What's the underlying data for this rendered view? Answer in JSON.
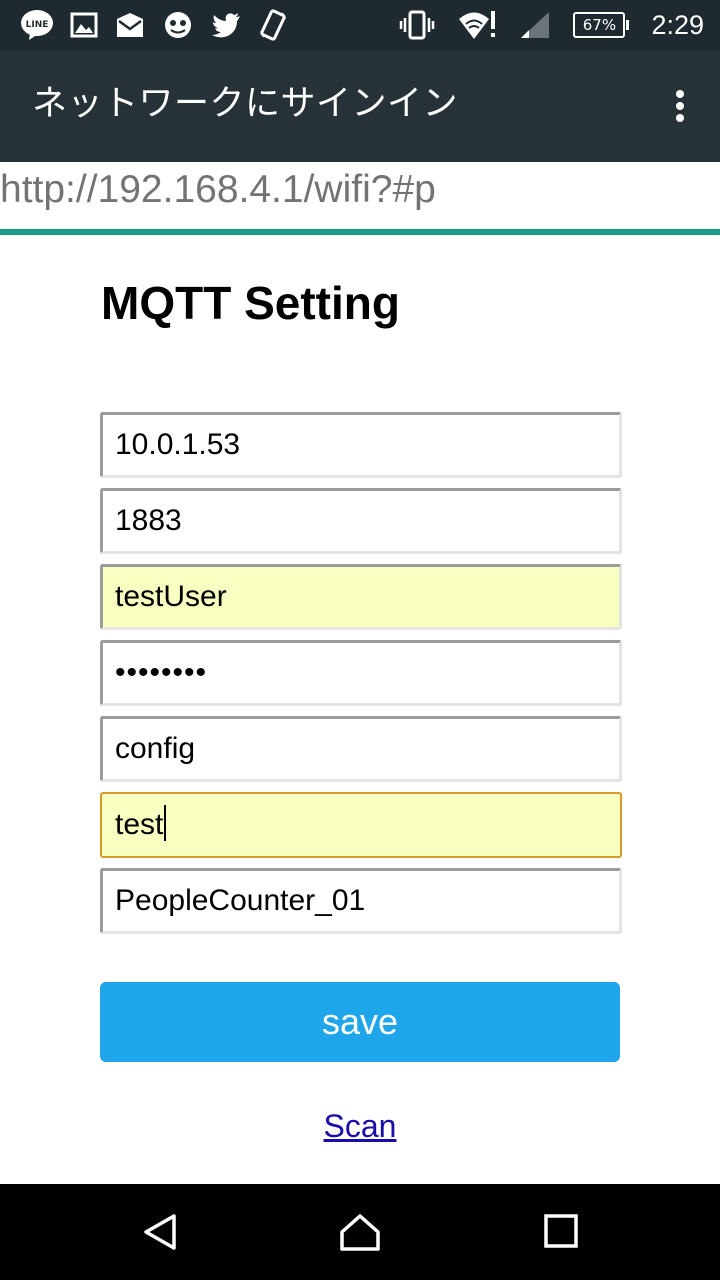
{
  "status_bar": {
    "battery_percent": "67%",
    "time": "2:29",
    "left_icons": [
      "line-icon",
      "image-icon",
      "mail-icon",
      "app-icon",
      "twitter-icon",
      "rotate-icon"
    ],
    "right_icons": [
      "vibrate-icon",
      "wifi-icon",
      "signal-icon",
      "battery-icon"
    ]
  },
  "app_bar": {
    "title": "ネットワークにサインイン"
  },
  "url_bar": {
    "url": "http://192.168.4.1/wifi?#p"
  },
  "page": {
    "title": "MQTT Setting",
    "fields": [
      {
        "value": "10.0.1.53",
        "style": "normal"
      },
      {
        "value": "1883",
        "style": "normal"
      },
      {
        "value": "testUser",
        "style": "autofill"
      },
      {
        "value": "••••••••",
        "style": "masked"
      },
      {
        "value": "config",
        "style": "normal"
      },
      {
        "value": "test",
        "style": "focused"
      },
      {
        "value": "PeopleCounter_01",
        "style": "normal"
      }
    ],
    "save_label": "save",
    "scan_label": "Scan"
  },
  "colors": {
    "status_bar_bg": "#1f2a30",
    "app_bar_bg": "#263238",
    "progress_line": "#1a9a8c",
    "autofill_bg": "#f9ffc0",
    "focus_border": "#d99a2c",
    "save_button_bg": "#1ea5ea",
    "link": "#1a0dab"
  },
  "nav_bar": {
    "buttons": [
      "back-icon",
      "home-icon",
      "recents-icon"
    ]
  }
}
